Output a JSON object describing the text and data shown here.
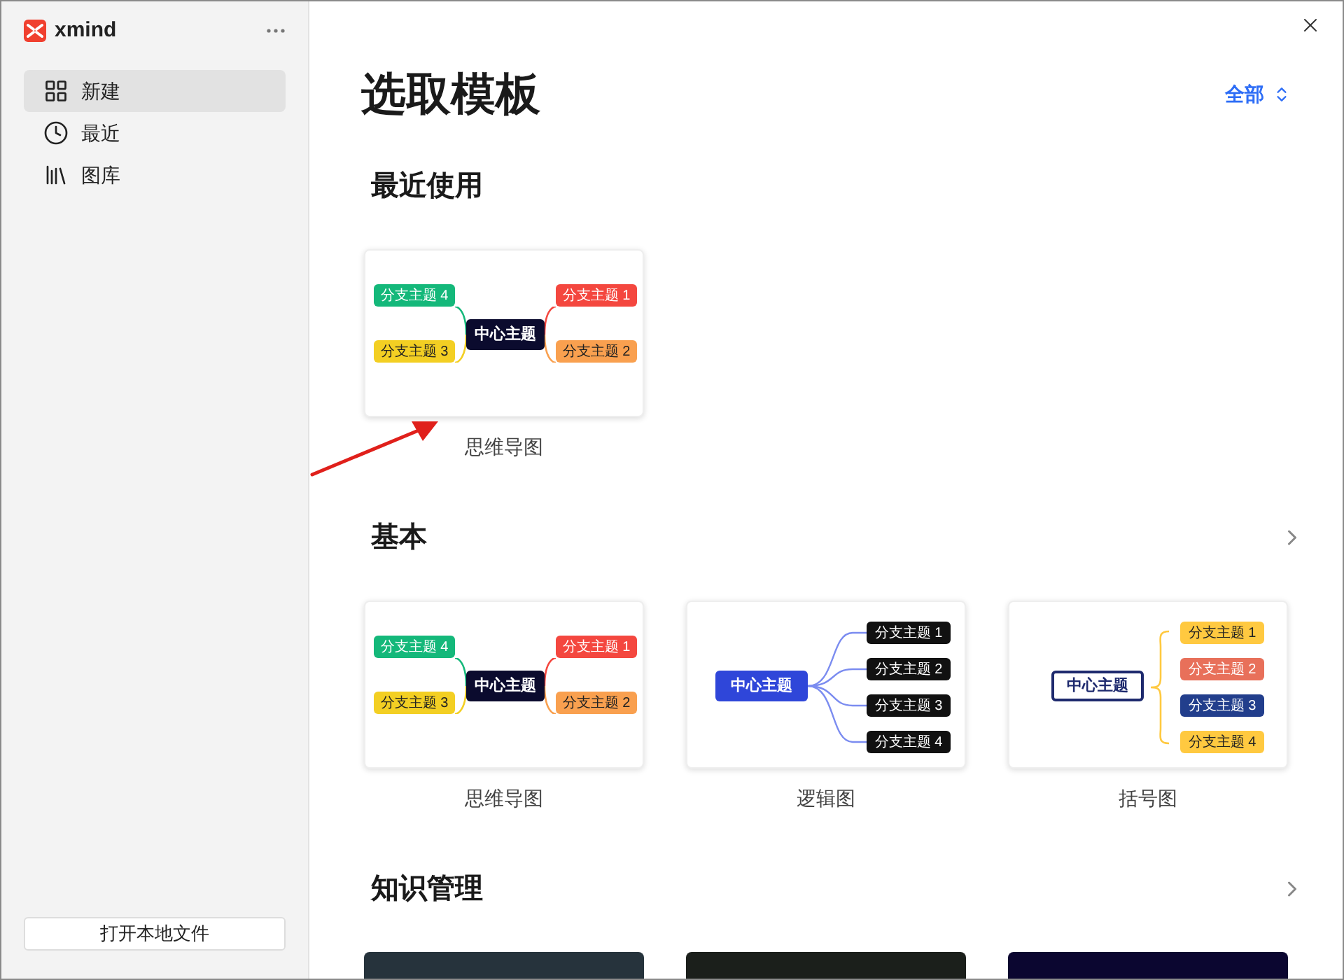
{
  "sidebar": {
    "app_name": "xmind",
    "items": [
      {
        "label": "新建",
        "selected": true
      },
      {
        "label": "最近",
        "selected": false
      },
      {
        "label": "图库",
        "selected": false
      }
    ],
    "open_button": "打开本地文件"
  },
  "main": {
    "title": "选取模板",
    "filter": "全部",
    "sections": [
      {
        "title": "最近使用",
        "has_more": false,
        "templates": [
          {
            "kind": "mindmap",
            "label": "思维导图",
            "center": "中心主题",
            "branches": [
              {
                "text": "分支主题 4",
                "color": "#14b87a"
              },
              {
                "text": "分支主题 1",
                "color": "#f4473f"
              },
              {
                "text": "分支主题 3",
                "color": "#f3cf23"
              },
              {
                "text": "分支主题 2",
                "color": "#f9a04f"
              }
            ]
          }
        ]
      },
      {
        "title": "基本",
        "has_more": true,
        "templates": [
          {
            "kind": "mindmap",
            "label": "思维导图",
            "center": "中心主题",
            "branches": [
              {
                "text": "分支主题 4",
                "color": "#14b87a"
              },
              {
                "text": "分支主题 1",
                "color": "#f4473f"
              },
              {
                "text": "分支主题 3",
                "color": "#f3cf23"
              },
              {
                "text": "分支主题 2",
                "color": "#f9a04f"
              }
            ]
          },
          {
            "kind": "logic",
            "label": "逻辑图",
            "center": "中心主题",
            "branches": [
              {
                "text": "分支主题 1",
                "color": "#111111"
              },
              {
                "text": "分支主题 2",
                "color": "#111111"
              },
              {
                "text": "分支主题 3",
                "color": "#111111"
              },
              {
                "text": "分支主题 4",
                "color": "#111111"
              }
            ]
          },
          {
            "kind": "bracket",
            "label": "括号图",
            "center": "中心主题",
            "branches": [
              {
                "text": "分支主题 1",
                "color": "#ffc940"
              },
              {
                "text": "分支主题 2",
                "color": "#e8705a"
              },
              {
                "text": "分支主题 3",
                "color": "#223e8c"
              },
              {
                "text": "分支主题 4",
                "color": "#ffc940"
              }
            ]
          }
        ]
      },
      {
        "title": "知识管理",
        "has_more": true,
        "templates": [
          {
            "kind": "cover",
            "color": "#26333c"
          },
          {
            "kind": "cover",
            "color": "#1b1f1b"
          },
          {
            "kind": "cover",
            "color": "#0b0630"
          }
        ]
      }
    ]
  }
}
